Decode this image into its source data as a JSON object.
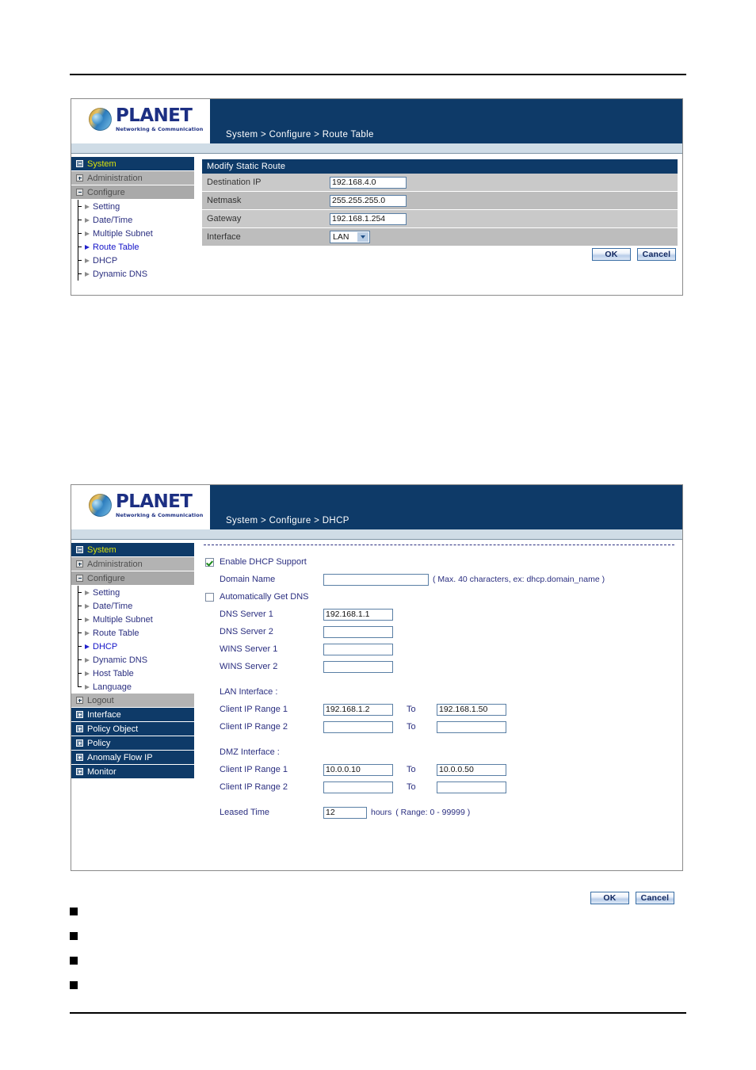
{
  "panel1": {
    "logo": {
      "name": "PLANET",
      "tagline": "Networking & Communication"
    },
    "breadcrumb": "System > Configure > Route Table",
    "sidebar": [
      {
        "label": "System",
        "type": "root",
        "state": "active",
        "icon": "minus-box-icon"
      },
      {
        "label": "Administration",
        "type": "group",
        "icon": "plus-box-icon"
      },
      {
        "label": "Configure",
        "type": "group-open",
        "icon": "minus-box-icon"
      },
      {
        "label": "Setting",
        "type": "leaf",
        "icon": "arrow-icon"
      },
      {
        "label": "Date/Time",
        "type": "leaf",
        "icon": "arrow-icon"
      },
      {
        "label": "Multiple Subnet",
        "type": "leaf",
        "icon": "arrow-icon"
      },
      {
        "label": "Route Table",
        "type": "leaf",
        "state": "active",
        "icon": "arrow-icon"
      },
      {
        "label": "DHCP",
        "type": "leaf",
        "icon": "arrow-icon"
      },
      {
        "label": "Dynamic DNS",
        "type": "leaf",
        "icon": "arrow-icon"
      }
    ],
    "form": {
      "title": "Modify Static Route",
      "rows": [
        {
          "label": "Destination IP",
          "value": "192.168.4.0"
        },
        {
          "label": "Netmask",
          "value": "255.255.255.0"
        },
        {
          "label": "Gateway",
          "value": "192.168.1.254"
        }
      ],
      "interface_label": "Interface",
      "interface_value": "LAN"
    },
    "buttons": {
      "ok": "OK",
      "cancel": "Cancel"
    }
  },
  "panel2": {
    "logo": {
      "name": "PLANET",
      "tagline": "Networking & Communication"
    },
    "breadcrumb": "System > Configure > DHCP",
    "sidebar": [
      {
        "label": "System",
        "type": "root",
        "state": "active",
        "icon": "minus-box-icon"
      },
      {
        "label": "Administration",
        "type": "group",
        "icon": "plus-box-icon"
      },
      {
        "label": "Configure",
        "type": "group-open",
        "icon": "minus-box-icon"
      },
      {
        "label": "Setting",
        "type": "leaf",
        "icon": "arrow-icon"
      },
      {
        "label": "Date/Time",
        "type": "leaf",
        "icon": "arrow-icon"
      },
      {
        "label": "Multiple Subnet",
        "type": "leaf",
        "icon": "arrow-icon"
      },
      {
        "label": "Route Table",
        "type": "leaf",
        "icon": "arrow-icon"
      },
      {
        "label": "DHCP",
        "type": "leaf",
        "state": "active",
        "icon": "arrow-icon"
      },
      {
        "label": "Dynamic DNS",
        "type": "leaf",
        "icon": "arrow-icon"
      },
      {
        "label": "Host Table",
        "type": "leaf",
        "icon": "arrow-icon"
      },
      {
        "label": "Language",
        "type": "leaf",
        "icon": "arrow-icon"
      },
      {
        "label": "Logout",
        "type": "group",
        "icon": "plus-box-icon"
      },
      {
        "label": "Interface",
        "type": "root",
        "icon": "plus-box-icon"
      },
      {
        "label": "Policy Object",
        "type": "root",
        "icon": "plus-box-icon"
      },
      {
        "label": "Policy",
        "type": "root",
        "icon": "plus-box-icon"
      },
      {
        "label": "Anomaly Flow IP",
        "type": "root",
        "icon": "plus-box-icon"
      },
      {
        "label": "Monitor",
        "type": "root",
        "icon": "plus-box-icon"
      }
    ],
    "form": {
      "enable_dhcp_label": "Enable DHCP Support",
      "enable_dhcp_checked": true,
      "domain_name_label": "Domain Name",
      "domain_name_value": "",
      "domain_name_hint": "( Max. 40 characters, ex: dhcp.domain_name )",
      "auto_dns_label": "Automatically Get DNS",
      "auto_dns_checked": false,
      "dns1_label": "DNS Server 1",
      "dns1_value": "192.168.1.1",
      "dns2_label": "DNS Server 2",
      "dns2_value": "",
      "wins1_label": "WINS Server 1",
      "wins1_value": "",
      "wins2_label": "WINS Server 2",
      "wins2_value": "",
      "lan_section": "LAN Interface :",
      "lan_range1_label": "Client IP Range 1",
      "lan_range1_from": "192.168.1.2",
      "lan_range1_to_label": "To",
      "lan_range1_to": "192.168.1.50",
      "lan_range2_label": "Client IP Range 2",
      "lan_range2_from": "",
      "lan_range2_to_label": "To",
      "lan_range2_to": "",
      "dmz_section": "DMZ Interface :",
      "dmz_range1_label": "Client IP Range 1",
      "dmz_range1_from": "10.0.0.10",
      "dmz_range1_to_label": "To",
      "dmz_range1_to": "10.0.0.50",
      "dmz_range2_label": "Client IP Range 2",
      "dmz_range2_from": "",
      "dmz_range2_to_label": "To",
      "dmz_range2_to": "",
      "leased_time_label": "Leased Time",
      "leased_time_value": "12",
      "leased_time_unit": "hours",
      "leased_time_hint": "( Range: 0 - 99999 )"
    },
    "buttons": {
      "ok": "OK",
      "cancel": "Cancel"
    }
  },
  "bullets": {
    "count": 4,
    "marker": "black-square"
  },
  "colors": {
    "navy": "#0e3a68",
    "sidebar_group": "#b3b3b3",
    "row_light": "#c9c9c9",
    "row_dark": "#bdbdbd",
    "active_nav_text": "#d8e00c",
    "link_text": "#2b2f80",
    "sub_strip": "#cfdce6"
  }
}
